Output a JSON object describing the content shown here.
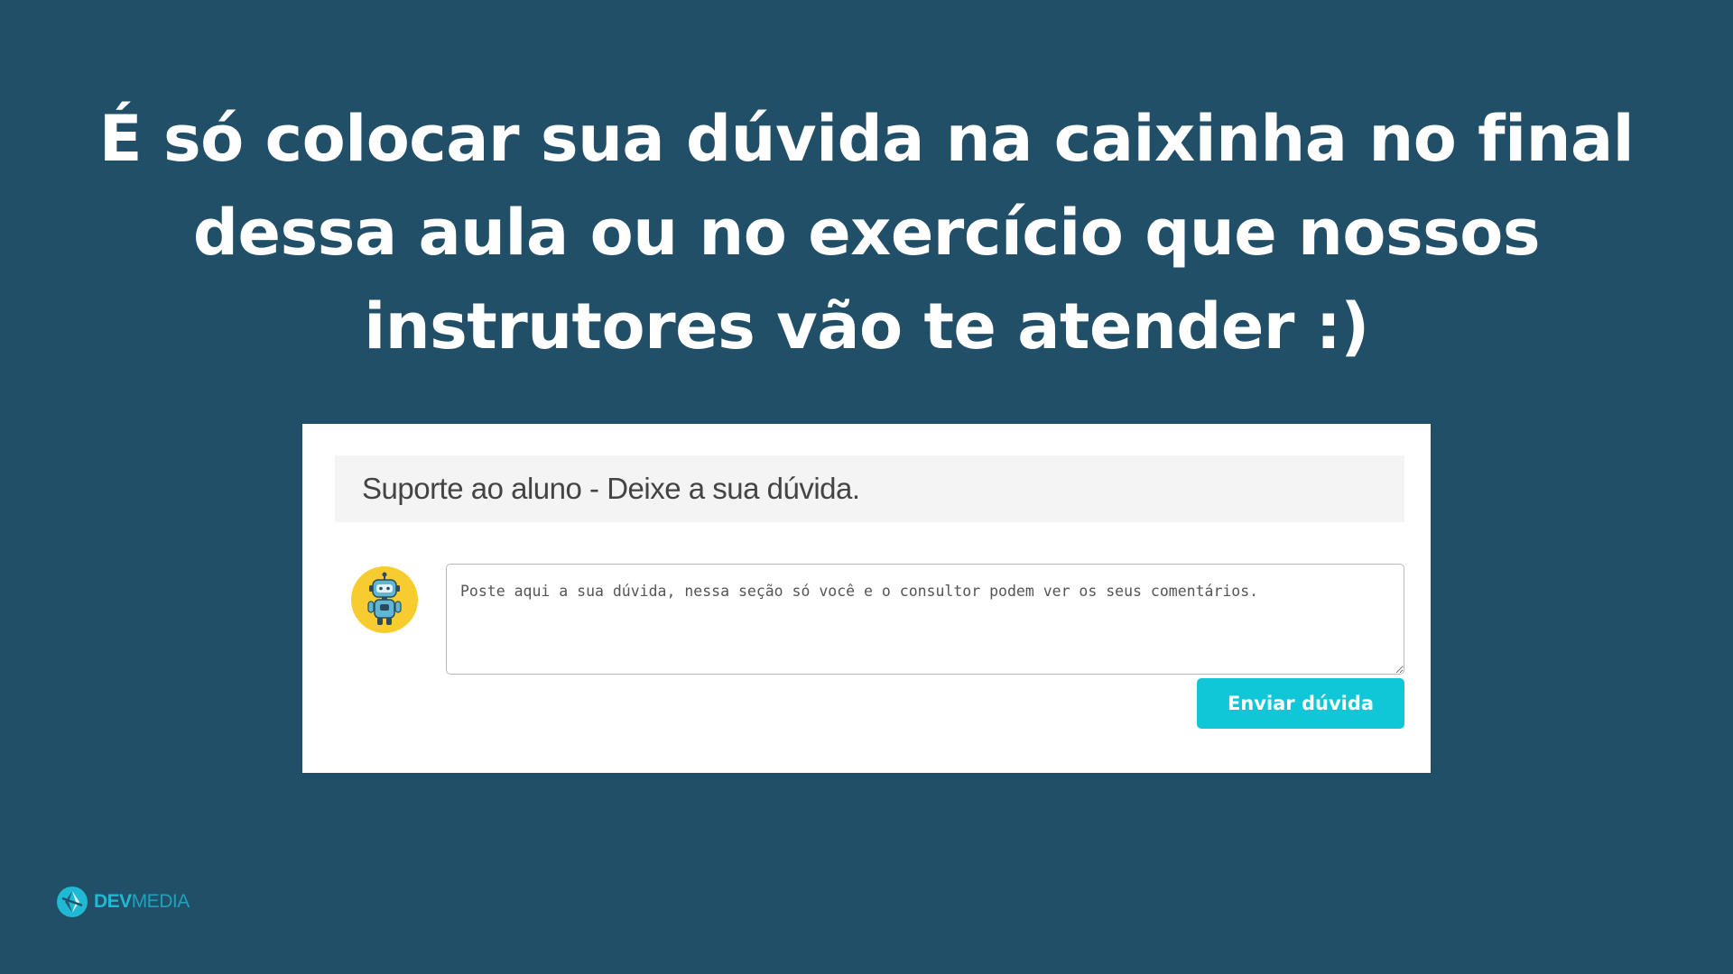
{
  "headline": {
    "lines": [
      "É só colocar sua dúvida na caixinha no final",
      "dessa aula ou no exercício que nossos",
      "instrutores vão te atender :)"
    ]
  },
  "support_card": {
    "title": "Suporte ao aluno - Deixe a sua dúvida.",
    "textarea_placeholder": "Poste aqui a sua dúvida, nessa seção só você e o consultor podem ver os seus comentários.",
    "textarea_value": "",
    "submit_label": "Enviar dúvida",
    "avatar_icon": "robot-icon"
  },
  "brand": {
    "logo_icon": "devmedia-logo-icon",
    "name_part1": "DEV",
    "name_part2": "MEDIA"
  },
  "colors": {
    "background": "#224f68",
    "accent_button": "#0fc7d6",
    "brand": "#1fb9d3",
    "avatar_bg": "#f6cc2e"
  }
}
